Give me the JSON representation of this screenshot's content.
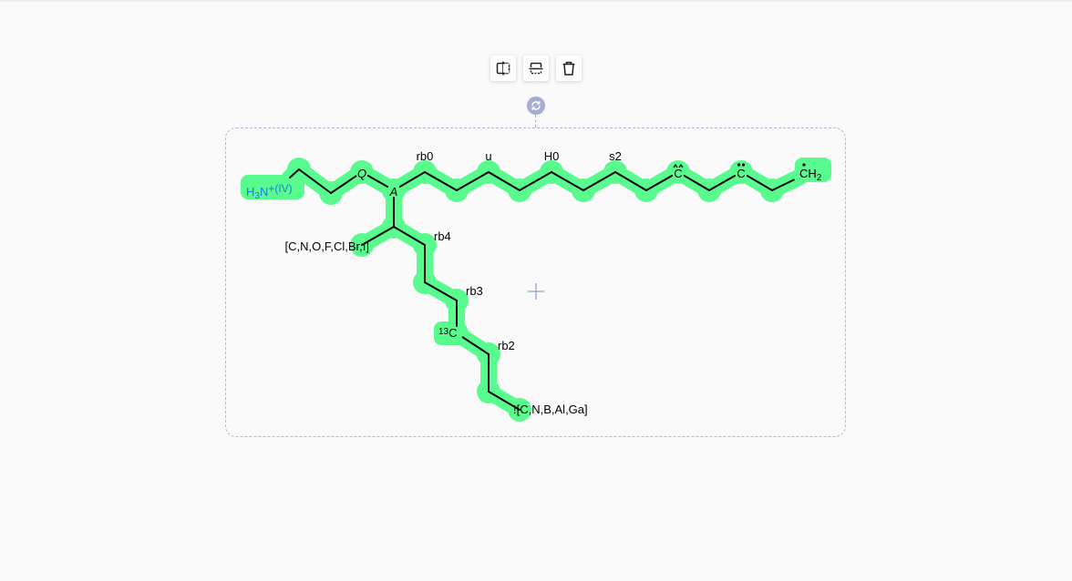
{
  "toolbar": {
    "buttons": [
      {
        "name": "flip-horizontal-button",
        "icon": "flip-horizontal-icon"
      },
      {
        "name": "flip-vertical-button",
        "icon": "flip-vertical-icon"
      },
      {
        "name": "delete-button",
        "icon": "trash-icon"
      }
    ]
  },
  "colors": {
    "highlight": "#5afb8e",
    "bond": "#000000",
    "selection": "#b5bbd3",
    "handle": "#a3aed0",
    "ion_text": "#1e7ce0"
  },
  "molecule": {
    "ion_label": {
      "main": "H",
      "sub": "3",
      "main2": "N",
      "sup": "+(IV)"
    },
    "atom_labels": {
      "q": "Q",
      "a": "A",
      "c_caret": "C",
      "c_dots": "C",
      "ch2_main": "CH",
      "ch2_sub": "2",
      "c13_sup": "13",
      "c13_main": "C"
    },
    "query_labels": {
      "list1": "[C,N,O,F,Cl,Br,I]",
      "list2": "![C,N,B,Al,Ga]",
      "rb0": "rb0",
      "u": "u",
      "h0": "H0",
      "s2": "s2",
      "rb4": "rb4",
      "rb3": "rb3",
      "rb2": "rb2"
    }
  }
}
